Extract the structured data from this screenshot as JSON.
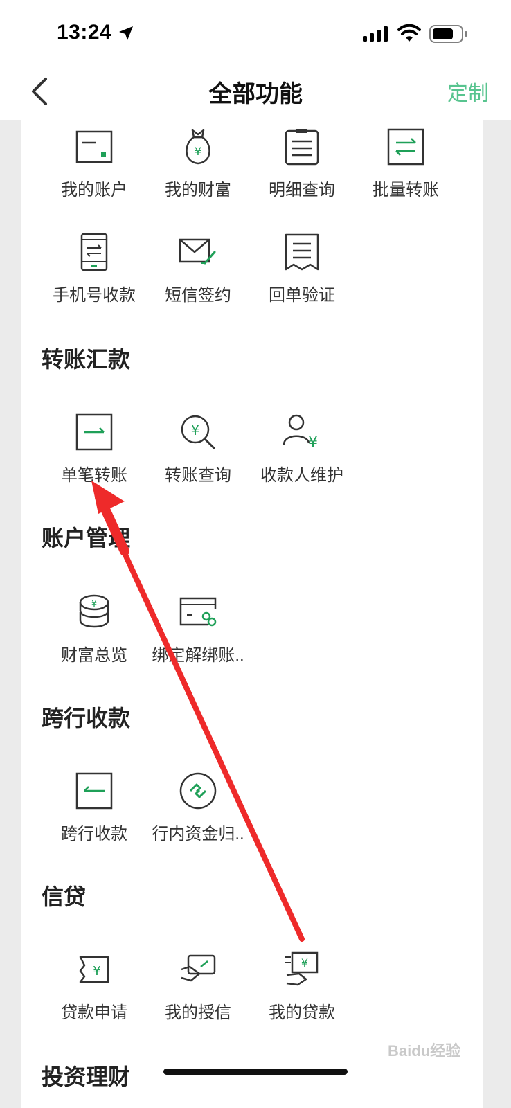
{
  "status_bar": {
    "time": "13:24"
  },
  "nav": {
    "title": "全部功能",
    "customize_label": "定制"
  },
  "sections": [
    {
      "title": "",
      "items": [
        {
          "label": "我的账户",
          "icon": "account-card-icon"
        },
        {
          "label": "我的财富",
          "icon": "money-bag-icon"
        },
        {
          "label": "明细查询",
          "icon": "clipboard-list-icon"
        },
        {
          "label": "批量转账",
          "icon": "batch-transfer-icon"
        },
        {
          "label": "手机号收款",
          "icon": "phone-transfer-icon"
        },
        {
          "label": "短信签约",
          "icon": "sms-envelope-icon"
        },
        {
          "label": "回单验证",
          "icon": "receipt-icon"
        }
      ]
    },
    {
      "title": "转账汇款",
      "items": [
        {
          "label": "单笔转账",
          "icon": "single-transfer-icon"
        },
        {
          "label": "转账查询",
          "icon": "transfer-search-icon"
        },
        {
          "label": "收款人维护",
          "icon": "payee-icon"
        }
      ]
    },
    {
      "title": "账户管理",
      "items": [
        {
          "label": "财富总览",
          "icon": "coin-stack-icon"
        },
        {
          "label": "绑定解绑账..",
          "icon": "card-link-icon"
        }
      ]
    },
    {
      "title": "跨行收款",
      "items": [
        {
          "label": "跨行收款",
          "icon": "interbank-receive-icon"
        },
        {
          "label": "行内资金归..",
          "icon": "fund-collect-icon"
        }
      ]
    },
    {
      "title": "信贷",
      "items": [
        {
          "label": "贷款申请",
          "icon": "loan-apply-icon"
        },
        {
          "label": "我的授信",
          "icon": "credit-card-hand-icon"
        },
        {
          "label": "我的贷款",
          "icon": "my-loan-icon"
        }
      ]
    },
    {
      "title": "投资理财",
      "items": []
    }
  ],
  "watermark": "Baidu经验",
  "colors": {
    "accent": "#58c48f",
    "icon_green": "#1fa058",
    "annotation_arrow": "#ee2a2a"
  }
}
